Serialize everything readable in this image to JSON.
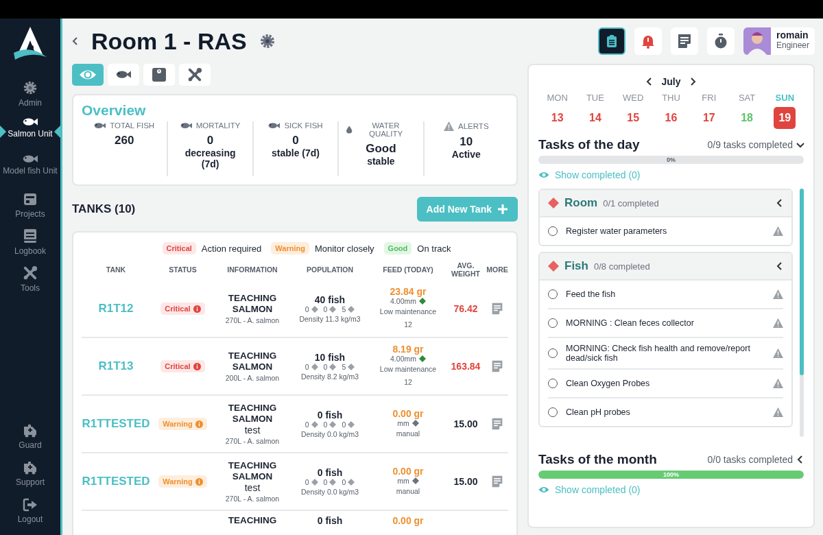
{
  "sidebar": {
    "items": [
      {
        "label": "Admin",
        "selected": false
      },
      {
        "label": "Salmon Unit",
        "selected": true
      },
      {
        "label": "Model fish Unit",
        "selected": false
      },
      {
        "label": "Projects",
        "selected": false
      },
      {
        "label": "Logbook",
        "selected": false
      },
      {
        "label": "Tools",
        "selected": false
      }
    ],
    "bottom_items": [
      {
        "label": "Guard"
      },
      {
        "label": "Support"
      },
      {
        "label": "Logout"
      }
    ]
  },
  "header": {
    "title": "Room 1 - RAS",
    "view_tabs": [
      {
        "selected": true
      },
      {
        "selected": false
      },
      {
        "selected": false
      },
      {
        "selected": false
      }
    ],
    "toolbar": [
      {
        "selected": true
      },
      {
        "selected": false
      },
      {
        "selected": false
      },
      {
        "selected": false
      }
    ],
    "user": {
      "name": "romain",
      "role": "Engineer"
    }
  },
  "overview": {
    "title": "Overview",
    "stats": [
      {
        "label": "TOTAL FISH",
        "value": "260"
      },
      {
        "label": "MORTALITY",
        "value": "0",
        "note": "decreasing (7d)"
      },
      {
        "label": "SICK FISH",
        "value": "0",
        "note": "stable (7d)"
      },
      {
        "label": "WATER QUALITY",
        "value": "Good",
        "note": "stable"
      },
      {
        "label": "ALERTS",
        "value": "10",
        "note": "Active"
      }
    ]
  },
  "tanks": {
    "title": "TANKS (10)",
    "add_button": "Add New Tank",
    "legend": [
      {
        "kind": "critical",
        "label": "Critical",
        "meaning": "Action required"
      },
      {
        "kind": "warning",
        "label": "Warning",
        "meaning": "Monitor closely"
      },
      {
        "kind": "good",
        "label": "Good",
        "meaning": "On track"
      }
    ],
    "columns": [
      "TANK",
      "STATUS",
      "INFORMATION",
      "POPULATION",
      "FEED (TODAY)",
      "AVG. WEIGHT",
      "MORE"
    ],
    "rows": [
      {
        "tank": "R1T12",
        "status": {
          "kind": "critical",
          "label": "Critical"
        },
        "info": "TEACHING SALMON",
        "volume": "270L - A. salmon",
        "population": "40 fish",
        "counts": [
          "0",
          "0",
          "5"
        ],
        "density": "Density 11.3 kg/m3",
        "feed": "23.84 gr",
        "pellet": {
          "size": "4.00mm",
          "color": "#2e8b3a"
        },
        "feed_plan": "Low maintenance 12",
        "weight": "76.42"
      },
      {
        "tank": "R1T13",
        "status": {
          "kind": "critical",
          "label": "Critical"
        },
        "info": "TEACHING SALMON",
        "volume": "200L - A. salmon",
        "population": "10 fish",
        "counts": [
          "0",
          "0",
          "5"
        ],
        "density": "Density 8.2 kg/m3",
        "feed": "8.19 gr",
        "pellet": {
          "size": "4.00mm",
          "color": "#2e8b3a"
        },
        "feed_plan": "Low maintenance 12",
        "weight": "163.84"
      },
      {
        "tank": "R1TTESTED",
        "status": {
          "kind": "warning",
          "label": "Warning"
        },
        "info": "TEACHING SALMON",
        "info_note": "test",
        "volume": "270L - A. salmon",
        "population": "0 fish",
        "counts": [
          "0",
          "0",
          "0"
        ],
        "density": "Density 0.0 kg/m3",
        "feed": "0.00 gr",
        "pellet": {
          "size": "mm",
          "color": "#6b7280"
        },
        "feed_plan": "manual",
        "weight": "15.00"
      },
      {
        "tank": "R1TTESTED",
        "status": {
          "kind": "warning",
          "label": "Warning"
        },
        "info": "TEACHING SALMON",
        "info_note": "test",
        "volume": "270L - A. salmon",
        "population": "0 fish",
        "counts": [
          "0",
          "0",
          "0"
        ],
        "density": "Density 0.0 kg/m3",
        "feed": "0.00 gr",
        "pellet": {
          "size": "mm",
          "color": "#6b7280"
        },
        "feed_plan": "manual",
        "weight": "15.00"
      }
    ],
    "partial_row": {
      "info": "TEACHING",
      "population": "0 fish",
      "feed": "0.00 gr"
    }
  },
  "calendar": {
    "month": "July",
    "days": [
      {
        "weekday": "MON",
        "date": "13",
        "color": "#e0443e",
        "selected": false
      },
      {
        "weekday": "TUE",
        "date": "14",
        "color": "#e0443e",
        "selected": false
      },
      {
        "weekday": "WED",
        "date": "15",
        "color": "#e0443e",
        "selected": false
      },
      {
        "weekday": "THU",
        "date": "16",
        "color": "#e0443e",
        "selected": false
      },
      {
        "weekday": "FRI",
        "date": "17",
        "color": "#e0443e",
        "selected": false
      },
      {
        "weekday": "SAT",
        "date": "18",
        "color": "#5cc36a",
        "selected": false
      },
      {
        "weekday": "SUN",
        "date": "19",
        "color": "#e0443e",
        "selected": true
      }
    ]
  },
  "tasks_day": {
    "title": "Tasks of the day",
    "summary": "0/9 tasks completed",
    "expanded": true,
    "level": 0,
    "percent": "0%",
    "show_completed": "Show completed (0)",
    "groups": [
      {
        "name": "Room",
        "summary": "0/1 completed",
        "color": "#e86161",
        "tasks": [
          {
            "label": "Register water parameters",
            "checked": false
          }
        ]
      },
      {
        "name": "Fish",
        "summary": "0/8 completed",
        "color": "#e86161",
        "tasks": [
          {
            "label": "Feed the fish",
            "checked": false
          },
          {
            "label": "MORNING : Clean feces collector",
            "checked": false
          },
          {
            "label": "MORNING: Check fish health and remove/report dead/sick fish",
            "checked": false
          },
          {
            "label": "Clean Oxygen Probes",
            "checked": false
          },
          {
            "label": "Clean pH probes",
            "checked": false
          }
        ]
      }
    ]
  },
  "tasks_month": {
    "title": "Tasks of the month",
    "summary": "0/0 tasks completed",
    "expanded": false,
    "level": 1,
    "percent": "100%",
    "show_completed": "Show completed (0)"
  }
}
